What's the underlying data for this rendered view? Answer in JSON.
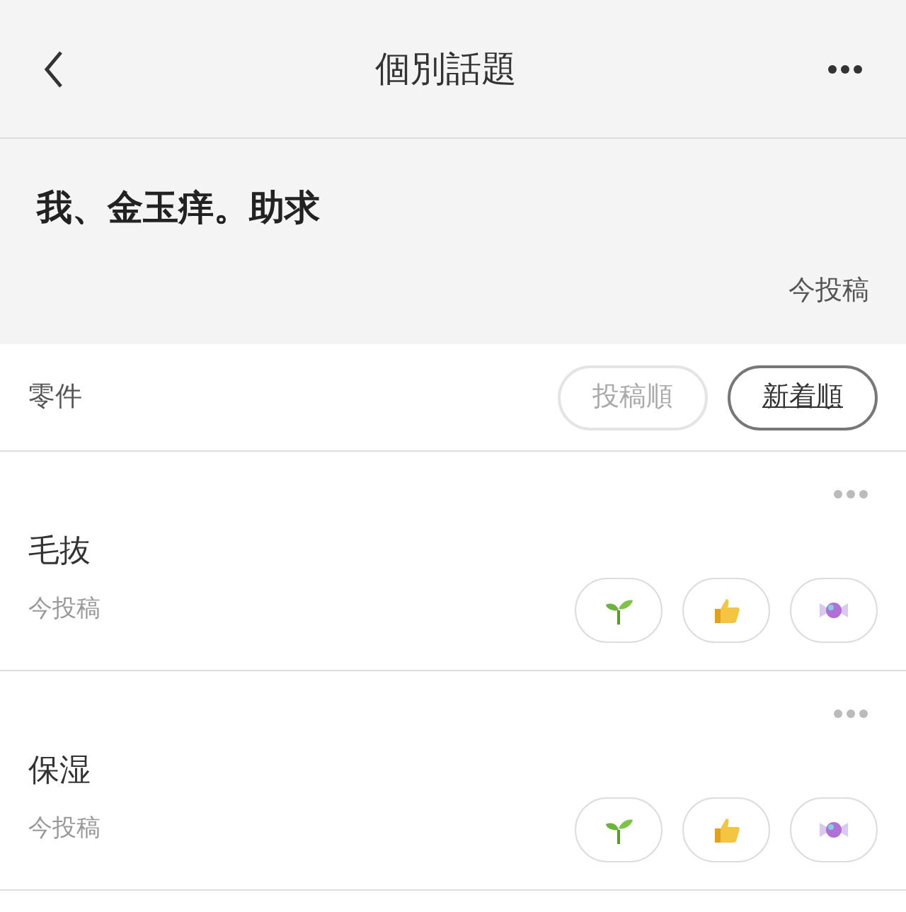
{
  "header": {
    "title": "個別話題"
  },
  "post": {
    "text": "我、金玉痒。助求",
    "time": "今投稿"
  },
  "sort_bar": {
    "count_label": "零件",
    "options": [
      {
        "label": "投稿順",
        "selected": false
      },
      {
        "label": "新着順",
        "selected": true
      }
    ]
  },
  "replies": [
    {
      "text": "毛抜",
      "time": "今投稿",
      "reactions": [
        {
          "kind": "sprout"
        },
        {
          "kind": "like"
        },
        {
          "kind": "candy"
        }
      ]
    },
    {
      "text": "保湿",
      "time": "今投稿",
      "reactions": [
        {
          "kind": "sprout"
        },
        {
          "kind": "like"
        },
        {
          "kind": "candy"
        }
      ]
    }
  ]
}
